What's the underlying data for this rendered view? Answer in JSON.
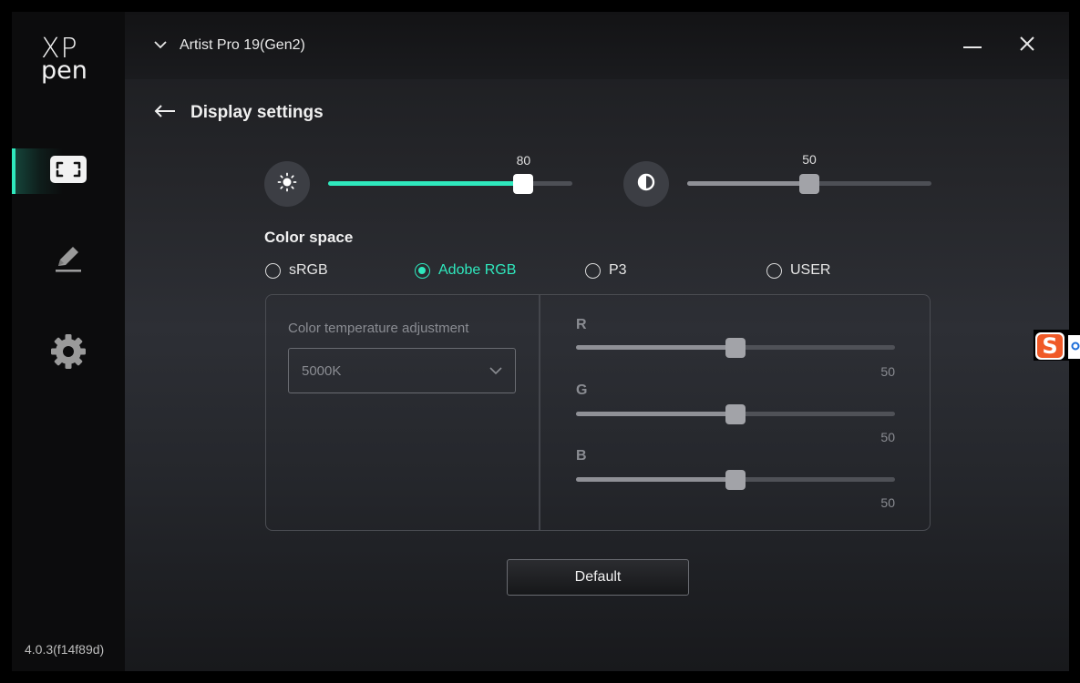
{
  "app": {
    "logo_line1": "XP",
    "logo_line2": "pen",
    "version": "4.0.3(f14f89d)",
    "accent": "#2fe8bd"
  },
  "sidebar": {
    "items": [
      {
        "name": "display",
        "icon": "display-frame-icon",
        "active": true
      },
      {
        "name": "pen",
        "icon": "pen-icon",
        "active": false
      },
      {
        "name": "settings",
        "icon": "gear-icon",
        "active": false
      }
    ]
  },
  "titlebar": {
    "device": "Artist Pro 19(Gen2)",
    "icons": [
      "chevron-down-icon",
      "minimize-icon",
      "close-icon"
    ]
  },
  "page": {
    "title": "Display settings",
    "back_icon": "back-arrow-icon"
  },
  "brightness": {
    "icon": "brightness-icon",
    "value": "80",
    "percent": 80
  },
  "contrast": {
    "icon": "contrast-icon",
    "value": "50",
    "percent": 50
  },
  "color_space": {
    "title": "Color space",
    "options": [
      {
        "label": "sRGB",
        "checked": false
      },
      {
        "label": "Adobe RGB",
        "checked": true
      },
      {
        "label": "P3",
        "checked": false
      },
      {
        "label": "USER",
        "checked": false
      }
    ]
  },
  "color_temperature": {
    "label": "Color temperature adjustment",
    "value": "5000K"
  },
  "rgb": [
    {
      "label": "R",
      "value": "50",
      "percent": 50
    },
    {
      "label": "G",
      "value": "50",
      "percent": 50
    },
    {
      "label": "B",
      "value": "50",
      "percent": 50
    }
  ],
  "default_button": "Default"
}
